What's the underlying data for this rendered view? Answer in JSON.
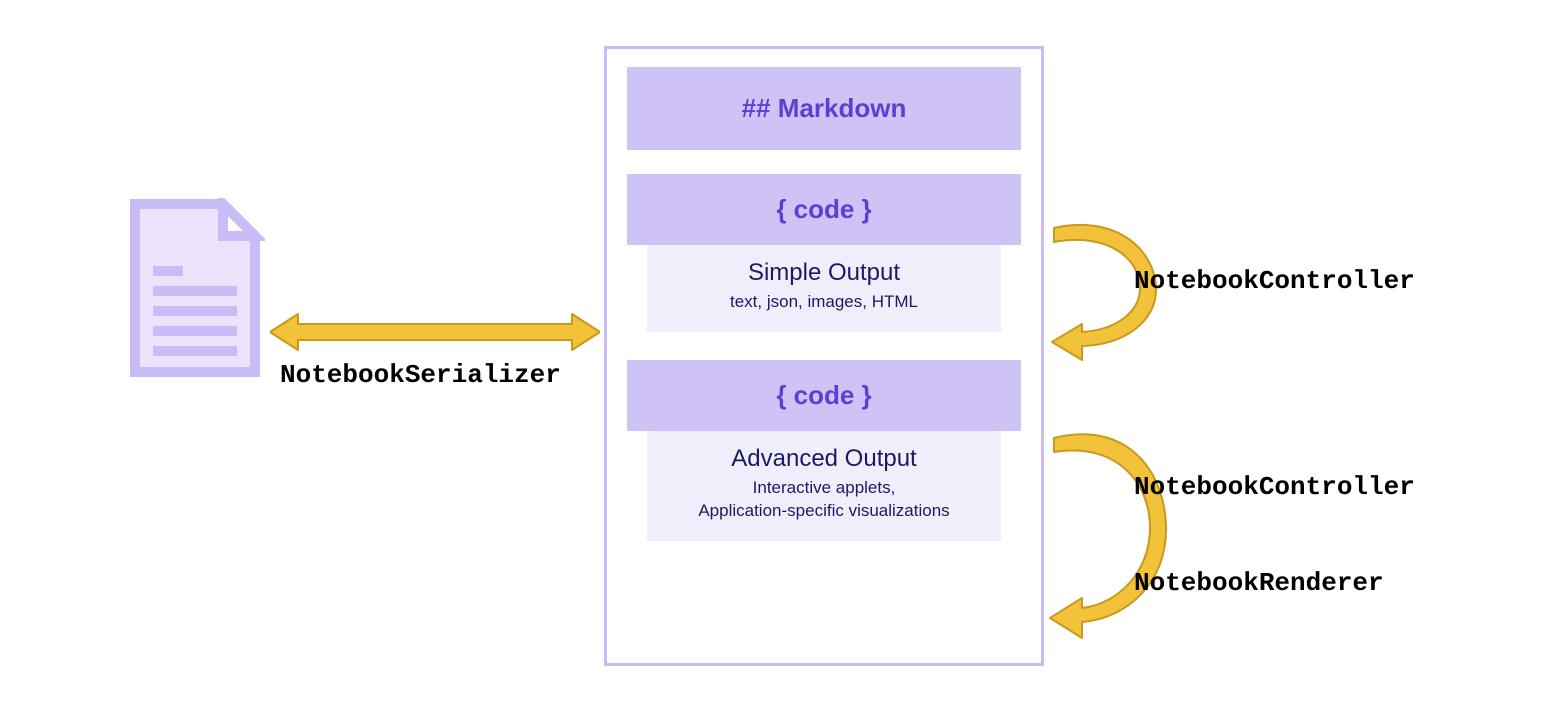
{
  "colors": {
    "lavender": "#cfc2f4",
    "lavender_border": "#c9bbf5",
    "lavender_light": "#f1eefc",
    "purple_text": "#5e3fd6",
    "navy_text": "#1a1a66",
    "arrow_fill": "#f2c23a",
    "arrow_stroke": "#c9991c"
  },
  "file_icon": {
    "name": "document"
  },
  "serializer": {
    "label": "NotebookSerializer"
  },
  "notebook": {
    "markdown_cell": "## Markdown",
    "group1": {
      "code_label": "{ code }",
      "output_title": "Simple Output",
      "output_sub": "text, json, images, HTML"
    },
    "group2": {
      "code_label": "{ code }",
      "output_title": "Advanced Output",
      "output_sub_line1": "Interactive applets,",
      "output_sub_line2": "Application-specific visualizations"
    }
  },
  "right": {
    "controller1": "NotebookController",
    "controller2": "NotebookController",
    "renderer": "NotebookRenderer"
  }
}
